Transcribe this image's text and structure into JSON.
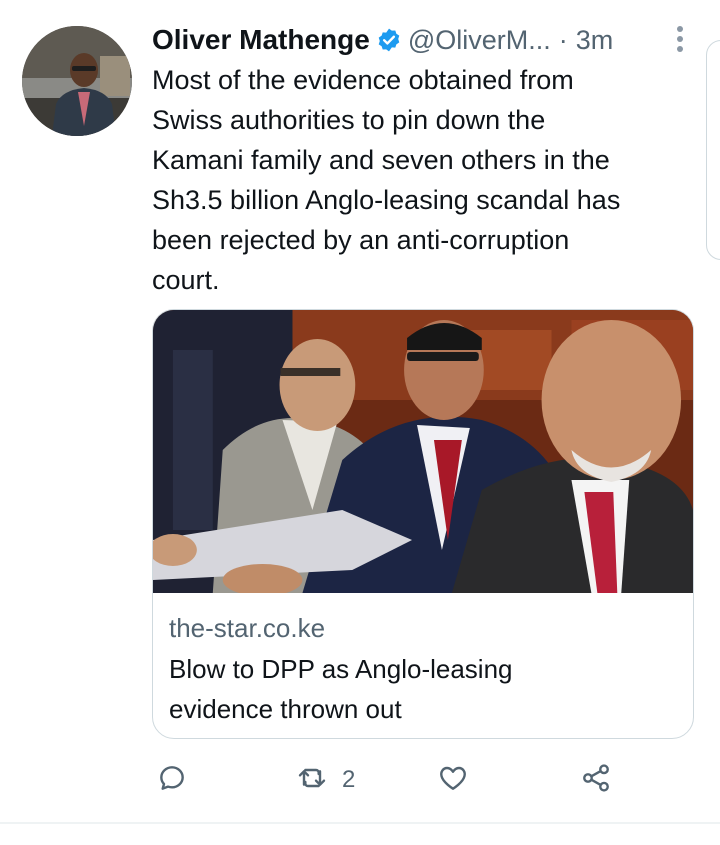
{
  "tweet": {
    "author_name": "Oliver Mathenge",
    "handle": "@OliverM...",
    "separator": "·",
    "time": "3m",
    "text": "Most of the evidence obtained from\nSwiss authorities to pin down the\nKamani family and seven others in the\nSh3.5 billion Anglo-leasing scandal has\nbeen rejected by an anti-corruption\ncourt.",
    "verified_icon": "verified-badge-icon",
    "more_icon": "more-vertical-icon"
  },
  "card": {
    "domain": "the-star.co.ke",
    "title": "Blow to DPP as Anglo-leasing\nevidence thrown out",
    "image_icon": "news-photo"
  },
  "actions": {
    "reply_icon": "reply-icon",
    "retweet_icon": "retweet-icon",
    "retweet_count": "2",
    "like_icon": "heart-icon",
    "share_icon": "share-icon"
  },
  "colors": {
    "text_primary": "#0f1419",
    "text_secondary": "#536471",
    "verified_blue": "#1d9bf0",
    "border": "#cfd9de"
  }
}
